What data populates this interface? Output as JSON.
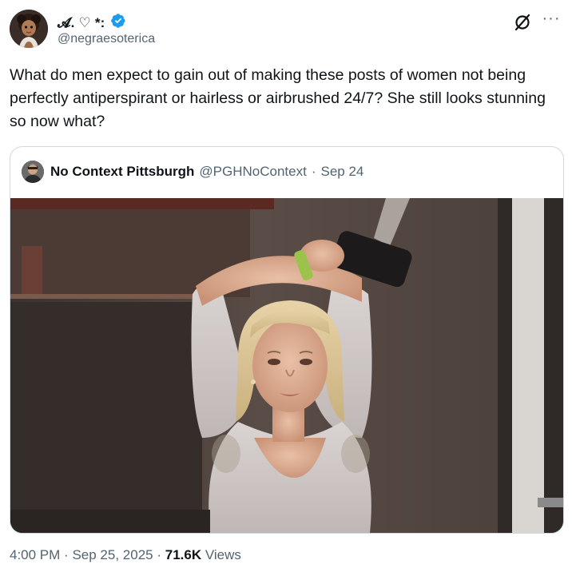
{
  "tweet": {
    "author": {
      "display_name": "𝓐. ♡ *:",
      "handle": "@negraesoterica",
      "verified": true,
      "verified_color": "#1d9bf0"
    },
    "text": "What do men expect to gain out of making these posts of women not being perfectly antiperspirant or hairless or airbrushed 24/7? She still looks stunning so now what?",
    "time": "4:00 PM",
    "separator": "·",
    "date": "Sep 25, 2025",
    "views_count": "71.6K",
    "views_label": "Views"
  },
  "quoted_tweet": {
    "display_name": "No Context Pittsburgh",
    "handle": "@PGHNoContext",
    "separator": "·",
    "date": "Sep 24"
  },
  "icons": {
    "grok": "grok-icon",
    "more": "more-icon",
    "verified": "verified-badge-icon"
  },
  "more_glyph": "···"
}
